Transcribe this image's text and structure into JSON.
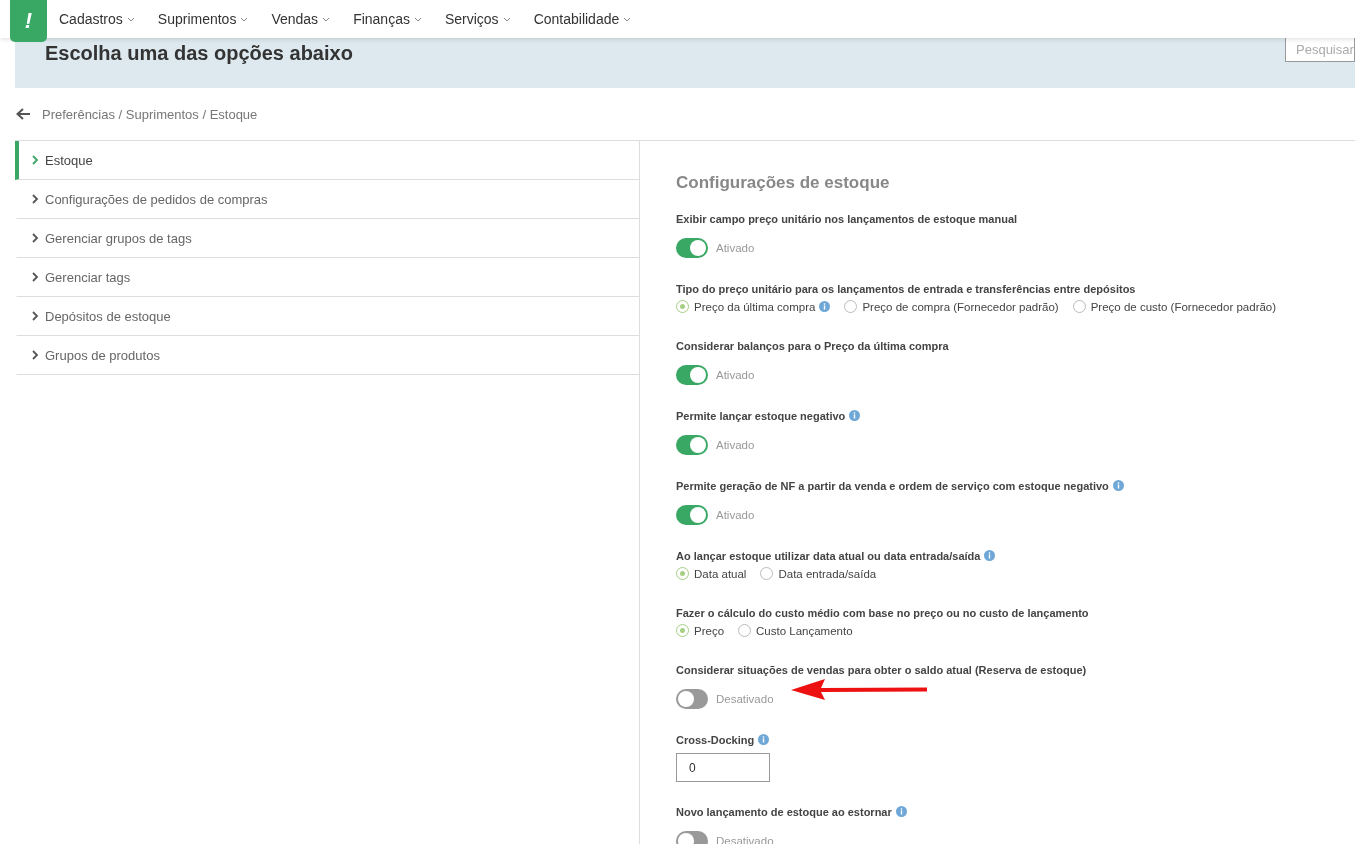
{
  "nav": {
    "logo": "!",
    "menus": [
      {
        "label": "Cadastros"
      },
      {
        "label": "Suprimentos"
      },
      {
        "label": "Vendas"
      },
      {
        "label": "Finanças"
      },
      {
        "label": "Serviços"
      },
      {
        "label": "Contabilidade"
      }
    ]
  },
  "banner": {
    "title": "Escolha uma das opções abaixo",
    "search": {
      "placeholder": "Pesquisar"
    }
  },
  "breadcrumb": "Preferências / Suprimentos / Estoque",
  "sidebar": {
    "items": [
      {
        "label": "Estoque",
        "selected": true
      },
      {
        "label": "Configurações de pedidos de compras",
        "selected": false
      },
      {
        "label": "Gerenciar grupos de tags",
        "selected": false
      },
      {
        "label": "Gerenciar tags",
        "selected": false
      },
      {
        "label": "Depósitos de estoque",
        "selected": false
      },
      {
        "label": "Grupos de produtos",
        "selected": false
      }
    ]
  },
  "panel": {
    "title": "Configurações de estoque",
    "settings": [
      {
        "kind": "toggle",
        "label": "Exibir campo preço unitário nos lançamentos de estoque manual",
        "info": false,
        "on": true,
        "state_text": "Ativado"
      },
      {
        "kind": "radio",
        "label": "Tipo do preço unitário para os lançamentos de entrada e transferências entre depósitos",
        "info": false,
        "options": [
          {
            "label": "Preço da última compra",
            "info": true,
            "selected": true
          },
          {
            "label": "Preço de compra (Fornecedor padrão)",
            "info": false,
            "selected": false
          },
          {
            "label": "Preço de custo (Fornecedor padrão)",
            "info": false,
            "selected": false
          }
        ]
      },
      {
        "kind": "toggle",
        "label": "Considerar balanços para o Preço da última compra",
        "info": false,
        "on": true,
        "state_text": "Ativado"
      },
      {
        "kind": "toggle",
        "label": "Permite lançar estoque negativo",
        "info": true,
        "on": true,
        "state_text": "Ativado"
      },
      {
        "kind": "toggle",
        "label": "Permite geração de NF a partir da venda e ordem de serviço com estoque negativo",
        "info": true,
        "on": true,
        "state_text": "Ativado"
      },
      {
        "kind": "radio",
        "label": "Ao lançar estoque utilizar data atual ou data entrada/saída",
        "info": true,
        "options": [
          {
            "label": "Data atual",
            "info": false,
            "selected": true
          },
          {
            "label": "Data entrada/saída",
            "info": false,
            "selected": false
          }
        ]
      },
      {
        "kind": "radio",
        "label": "Fazer o cálculo do custo médio com base no preço ou no custo de lançamento",
        "info": false,
        "options": [
          {
            "label": "Preço",
            "info": false,
            "selected": true
          },
          {
            "label": "Custo Lançamento",
            "info": false,
            "selected": false
          }
        ]
      },
      {
        "kind": "toggle",
        "label": "Considerar situações de vendas para obter o saldo atual (Reserva de estoque)",
        "info": false,
        "on": false,
        "state_text": "Desativado",
        "pointer_arrow": true
      },
      {
        "kind": "number",
        "label": "Cross-Docking",
        "info": true,
        "value": "0"
      },
      {
        "kind": "toggle",
        "label": "Novo lançamento de estoque ao estornar",
        "info": true,
        "on": false,
        "state_text": "Desativado"
      }
    ]
  }
}
